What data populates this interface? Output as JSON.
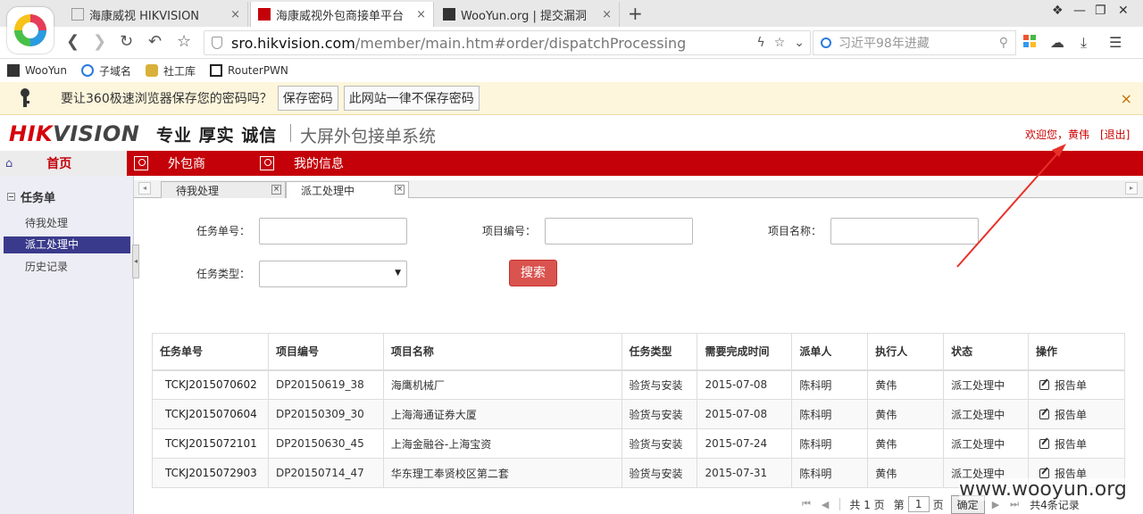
{
  "browser": {
    "tabs": [
      {
        "title": "海康威视 HIKVISION",
        "close": "×"
      },
      {
        "title": "海康威视外包商接单平台",
        "close": "×"
      },
      {
        "title": "WooYun.org | 提交漏洞",
        "close": "×"
      }
    ],
    "new_tab": "+",
    "address": {
      "host": "sro.hikvision.com",
      "path": "/member/main.htm#order/dispatchProcessing"
    },
    "search_placeholder": "习近平98年进藏",
    "bookmarks": [
      "WooYun",
      "子域名",
      "社工库",
      "RouterPWN"
    ],
    "password_bar": {
      "message": "要让360极速浏览器保存您的密码吗？",
      "save_label": "保存密码",
      "never_label": "此网站一律不保存密码",
      "close": "×"
    }
  },
  "header": {
    "logo_hi": "HIK",
    "logo_rest": "VISION",
    "slogan": "专业 厚实 诚信",
    "system_title": "大屏外包接单系统",
    "welcome": "欢迎您，黄伟",
    "logout": "[退出]"
  },
  "menu": {
    "home": "首页",
    "items": [
      "外包商",
      "我的信息"
    ]
  },
  "sidebar": {
    "group": "任务单",
    "items": [
      "待我处理",
      "派工处理中",
      "历史记录"
    ]
  },
  "content_tabs": [
    "待我处理",
    "派工处理中"
  ],
  "form": {
    "task_no_label": "任务单号：",
    "project_no_label": "项目编号：",
    "project_name_label": "项目名称：",
    "task_type_label": "任务类型：",
    "search_button": "搜索"
  },
  "table": {
    "headers": [
      "任务单号",
      "项目编号",
      "项目名称",
      "任务类型",
      "需要完成时间",
      "派单人",
      "执行人",
      "状态",
      "操作"
    ],
    "rows": [
      [
        "TCKJ2015070602",
        "DP20150619_38",
        "海鹰机械厂",
        "验货与安装",
        "2015-07-08",
        "陈科明",
        "黄伟",
        "派工处理中",
        "报告单"
      ],
      [
        "TCKJ2015070604",
        "DP20150309_30",
        "上海海通证券大厦",
        "验货与安装",
        "2015-07-08",
        "陈科明",
        "黄伟",
        "派工处理中",
        "报告单"
      ],
      [
        "TCKJ2015072101",
        "DP20150630_45",
        "上海金融谷-上海宝资",
        "验货与安装",
        "2015-07-24",
        "陈科明",
        "黄伟",
        "派工处理中",
        "报告单"
      ],
      [
        "TCKJ2015072903",
        "DP20150714_47",
        "华东理工奉贤校区第二套",
        "验货与安装",
        "2015-07-31",
        "陈科明",
        "黄伟",
        "派工处理中",
        "报告单"
      ]
    ]
  },
  "pager": {
    "total_pages_prefix": "共 1 页",
    "page_prefix": "第",
    "page_value": "1",
    "page_suffix": "页",
    "confirm": "确定",
    "record_count": "共4条记录"
  },
  "watermark": "www.wooyun.org",
  "colors": {
    "brand_red": "#c40008",
    "sidebar_active": "#3a3a8c",
    "search_button": "#d9534f"
  }
}
